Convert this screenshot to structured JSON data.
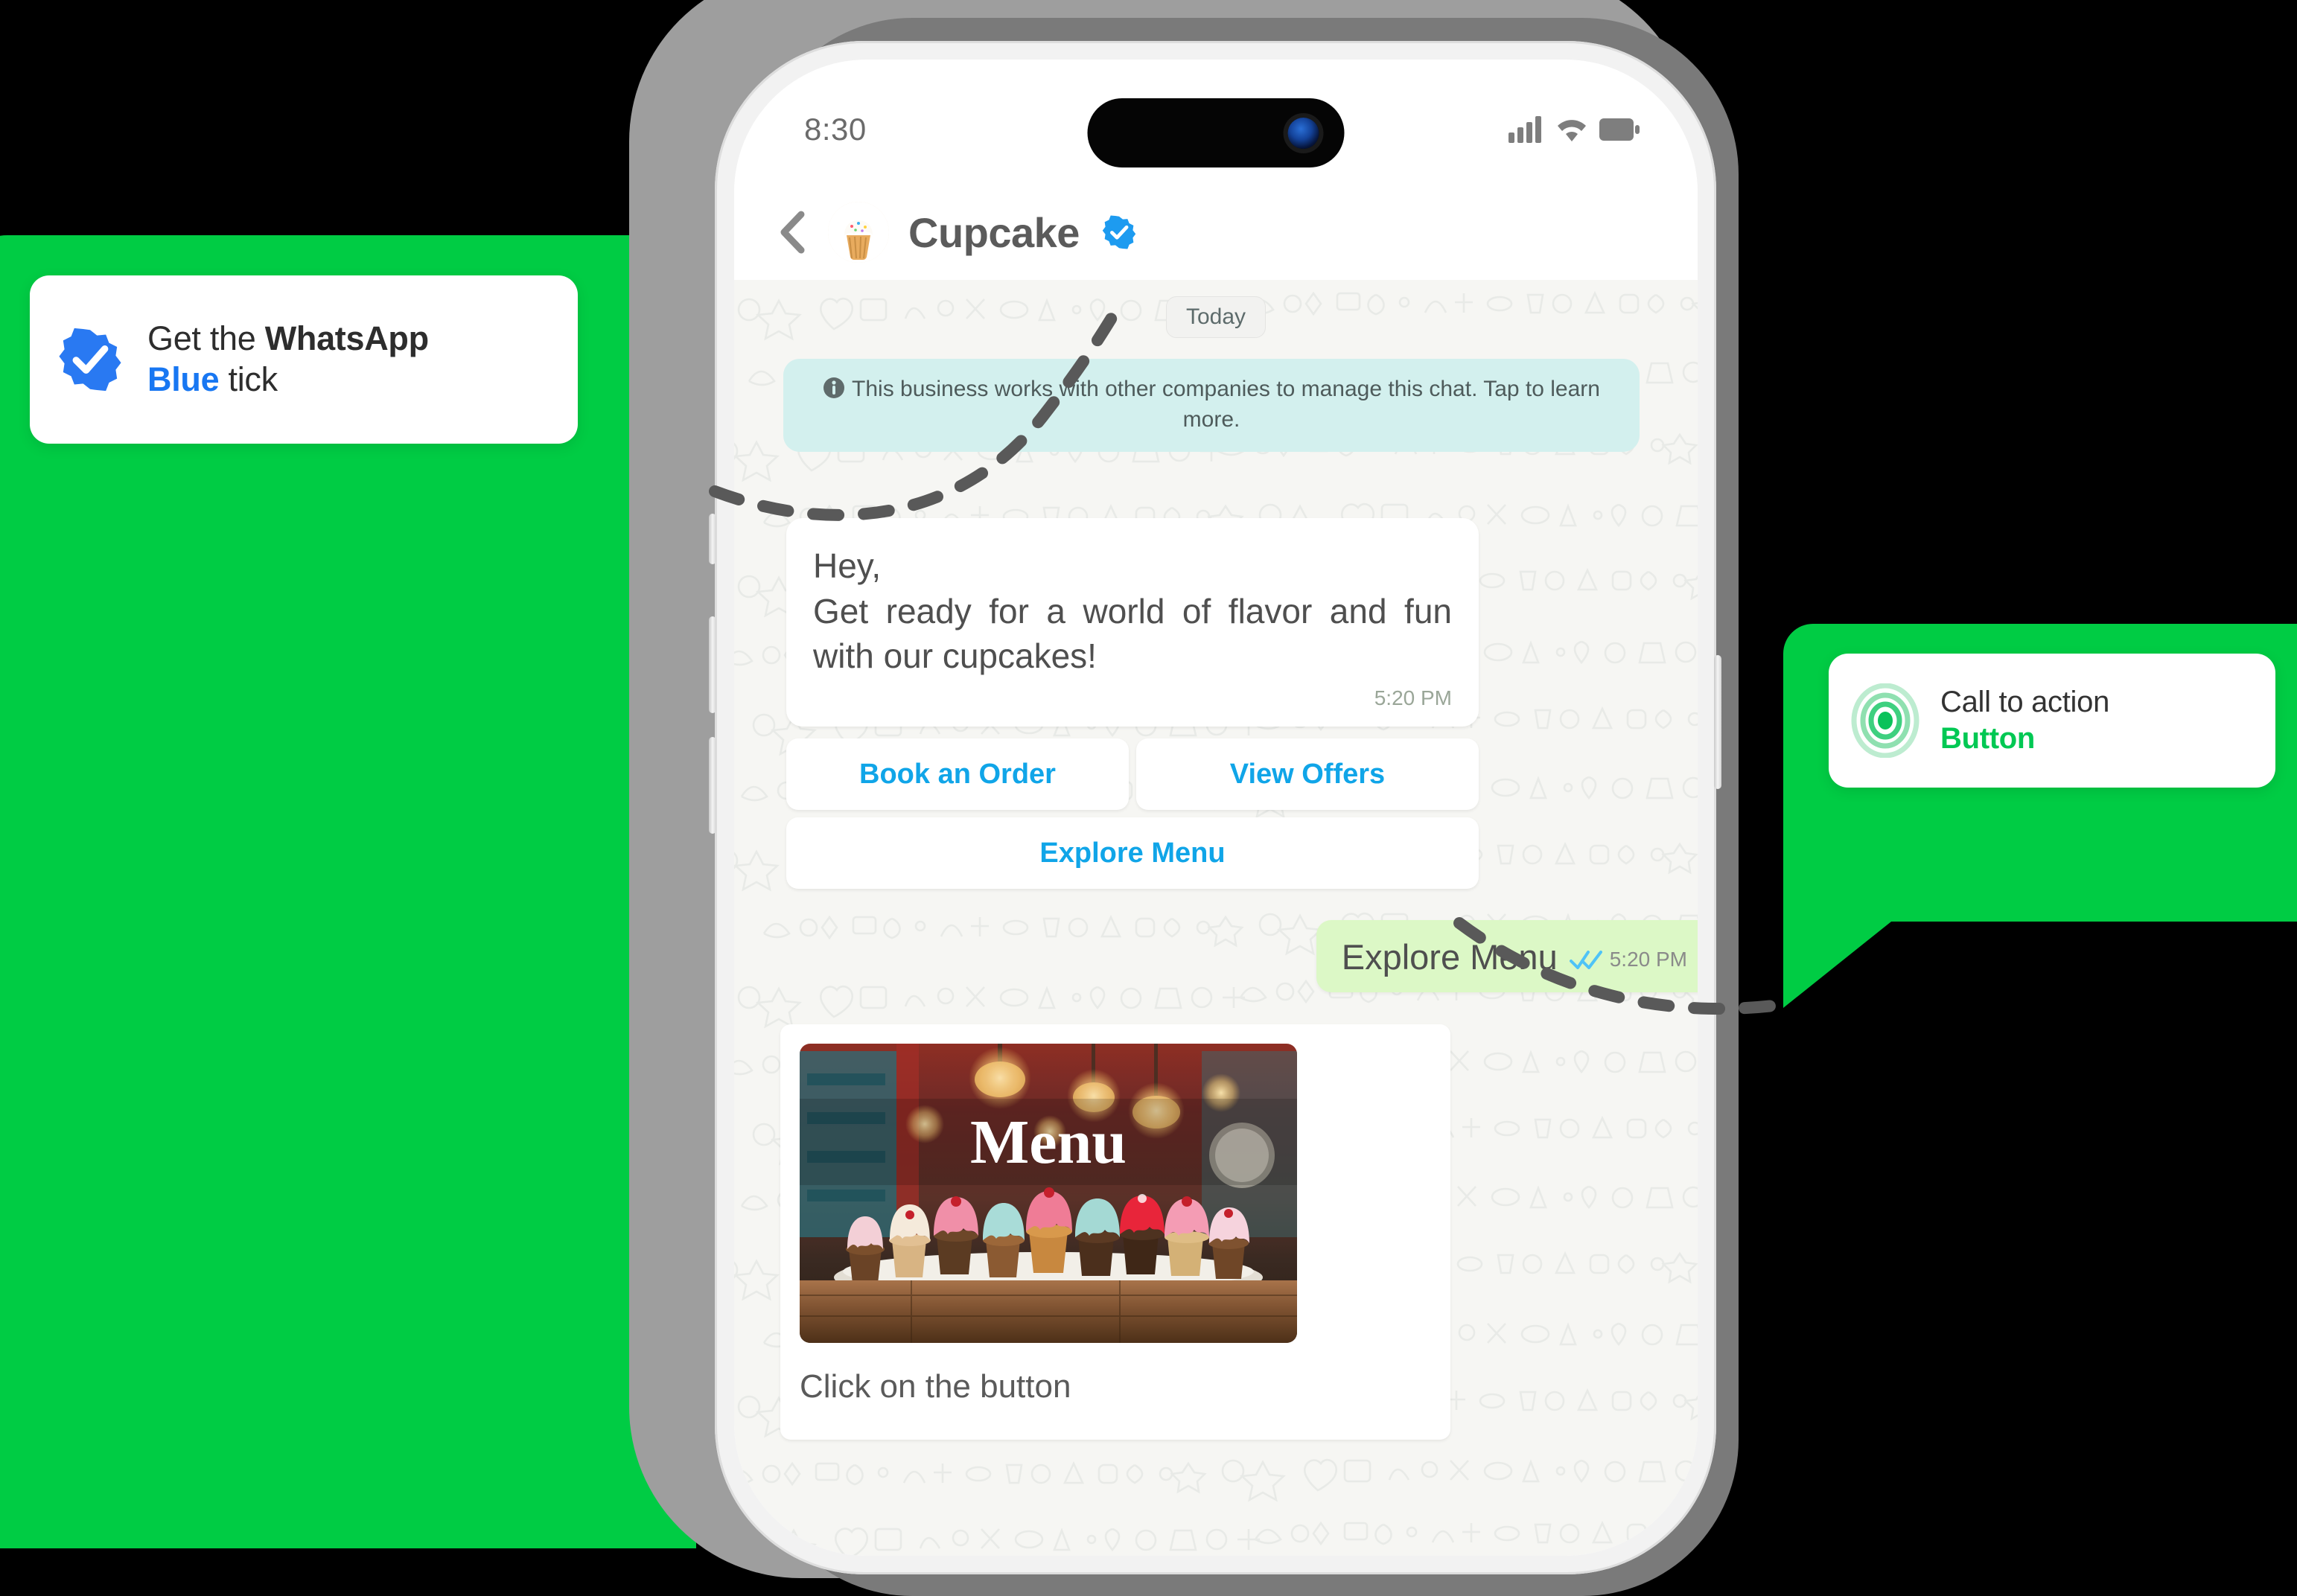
{
  "callouts": {
    "left": {
      "icon": "verified-badge-icon",
      "line1_plain": "Get the ",
      "line1_bold": "WhatsApp",
      "line2_accent": "Blue",
      "line2_plain": " tick",
      "accent_color": "#1877F2"
    },
    "right": {
      "icon": "target-rings-icon",
      "line1": "Call to action",
      "line2": "Button",
      "accent_color": "#00C853"
    }
  },
  "phone": {
    "statusbar": {
      "time": "8:30",
      "icons": [
        "cellular-signal-icon",
        "wifi-icon",
        "battery-icon"
      ]
    },
    "chat_header": {
      "back_icon": "back-chevron-icon",
      "avatar": "cupcake-avatar",
      "title": "Cupcake",
      "verified_icon": "verified-badge-icon"
    },
    "chat": {
      "day_chip": "Today",
      "info_banner": "This business works with other companies to manage this chat. Tap to learn more.",
      "incoming_message": {
        "text": "Hey,\nGet ready for a world of flavor and fun with our cupcakes!",
        "time": "5:20 PM"
      },
      "quick_reply_buttons": [
        "Book an Order",
        "View Offers",
        "Explore Menu"
      ],
      "outgoing_message": {
        "text": "Explore Menu",
        "time": "5:20 PM",
        "status_icon": "double-check-icon"
      },
      "media_card": {
        "image_title": "Menu",
        "caption": "Click on the button"
      }
    }
  },
  "colors": {
    "brand_green": "#00CC44",
    "bubble_out_green": "#DCF8C6",
    "link_blue": "#10A5E8",
    "info_banner_bg": "#D3F0EE"
  }
}
